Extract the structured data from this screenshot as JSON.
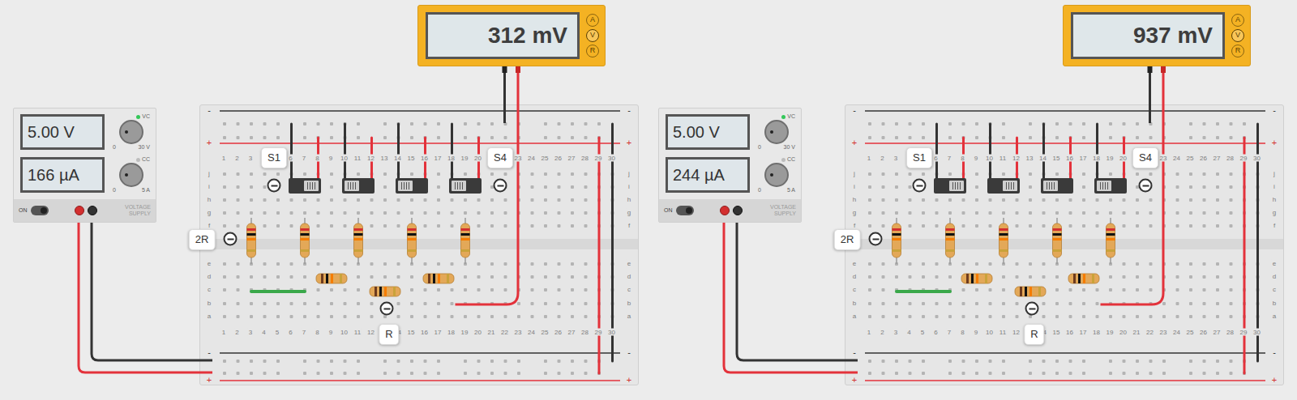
{
  "breadboard": {
    "rows": [
      "j",
      "i",
      "h",
      "g",
      "f",
      "e",
      "d",
      "c",
      "b",
      "a"
    ],
    "columns": [
      "1",
      "2",
      "3",
      "4",
      "5",
      "6",
      "7",
      "8",
      "9",
      "10",
      "11",
      "12",
      "13",
      "14",
      "15",
      "16",
      "17",
      "18",
      "19",
      "20",
      "21",
      "22",
      "23",
      "24",
      "25",
      "26",
      "27",
      "28",
      "29",
      "30"
    ],
    "rail_signs": {
      "negative": "-",
      "positive": "+"
    }
  },
  "panels": [
    {
      "multimeter": {
        "reading": "312 mV",
        "modes": [
          {
            "label": "A",
            "selected": false
          },
          {
            "label": "V",
            "selected": true
          },
          {
            "label": "R",
            "selected": false
          }
        ]
      },
      "supply": {
        "voltage": "5.00 V",
        "current": "166 µA",
        "power": {
          "label": "ON",
          "on": true
        },
        "indicators": [
          {
            "label": "VC",
            "on": true
          },
          {
            "label": "CC",
            "on": false
          }
        ],
        "scales": [
          {
            "min": "0",
            "max": "30 V"
          },
          {
            "min": "0",
            "max": "5 A"
          }
        ],
        "name": "VOLTAGE SUPPLY"
      },
      "switches": [
        {
          "label": "S1",
          "on": true
        },
        {
          "label": null,
          "on": false
        },
        {
          "label": null,
          "on": false
        },
        {
          "label": "S4",
          "on": false
        }
      ],
      "ladder_resistor_label": "2R",
      "series_resistor_label": "R"
    },
    {
      "multimeter": {
        "reading": "937 mV",
        "modes": [
          {
            "label": "A",
            "selected": false
          },
          {
            "label": "V",
            "selected": true
          },
          {
            "label": "R",
            "selected": false
          }
        ]
      },
      "supply": {
        "voltage": "5.00 V",
        "current": "244 µA",
        "power": {
          "label": "ON",
          "on": true
        },
        "indicators": [
          {
            "label": "VC",
            "on": true
          },
          {
            "label": "CC",
            "on": false
          }
        ],
        "scales": [
          {
            "min": "0",
            "max": "30 V"
          },
          {
            "min": "0",
            "max": "5 A"
          }
        ],
        "name": "VOLTAGE SUPPLY"
      },
      "switches": [
        {
          "label": "S1",
          "on": true
        },
        {
          "label": null,
          "on": true
        },
        {
          "label": null,
          "on": false
        },
        {
          "label": "S4",
          "on": false
        }
      ],
      "ladder_resistor_label": "2R",
      "series_resistor_label": "R"
    }
  ]
}
